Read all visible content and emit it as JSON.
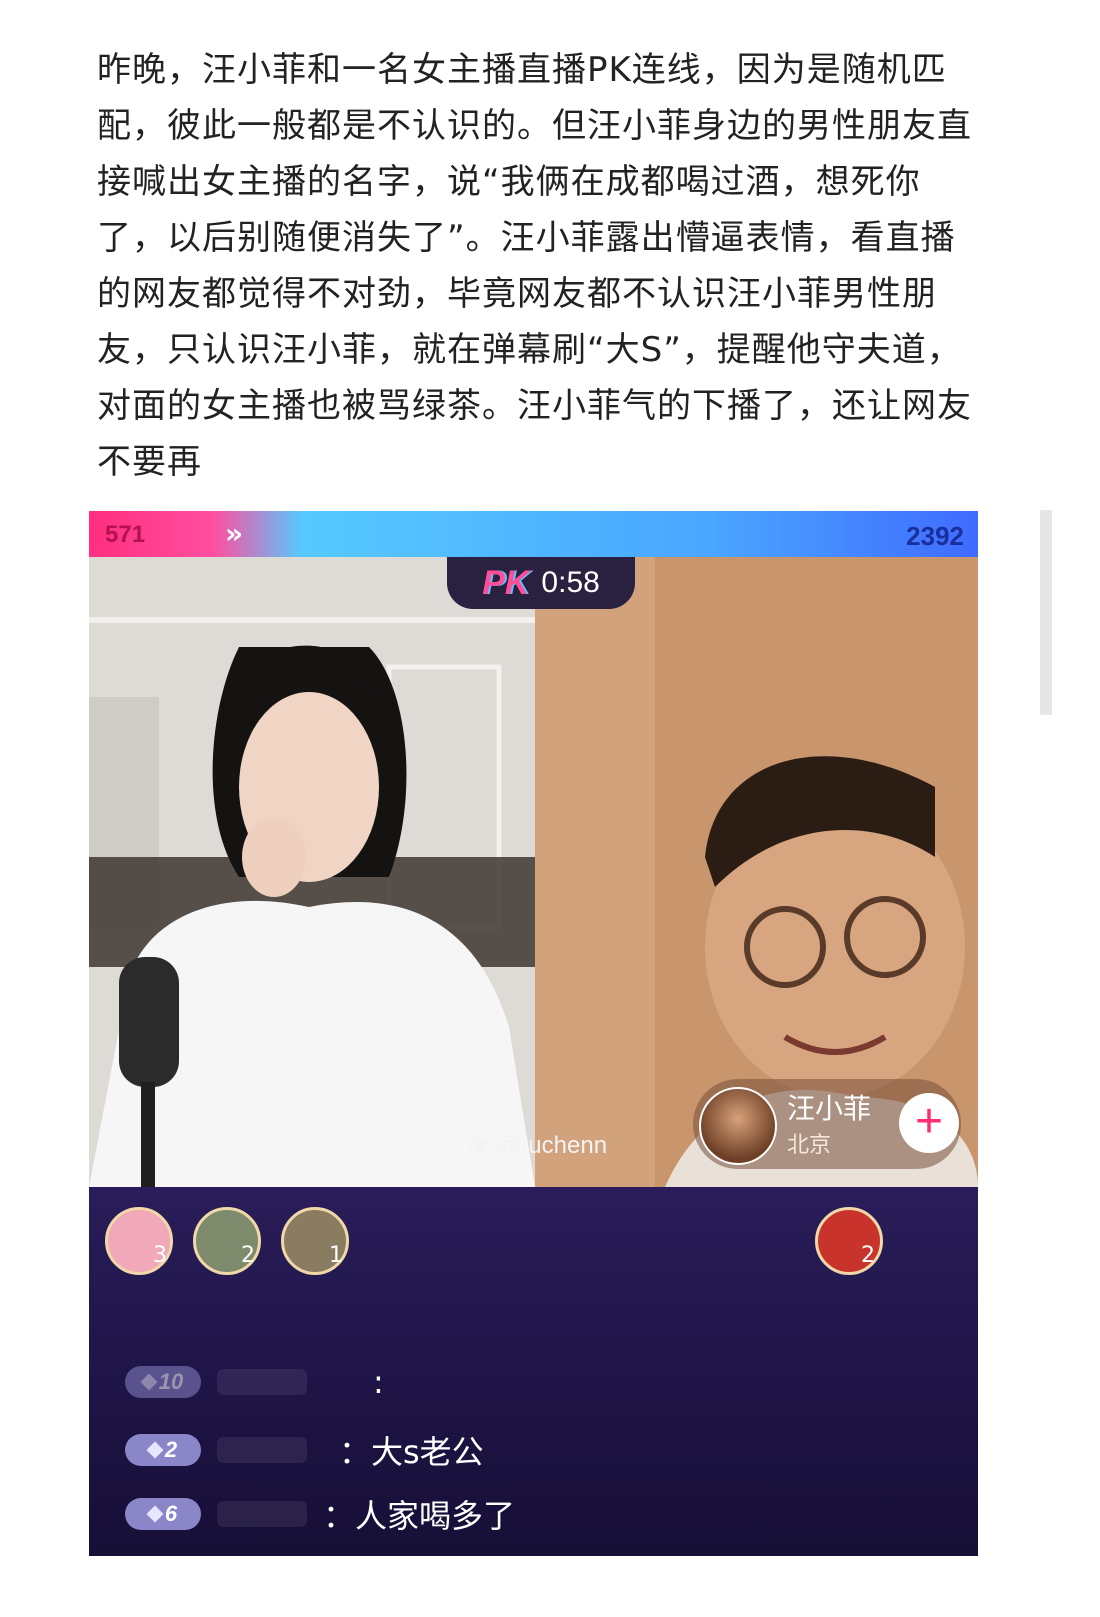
{
  "article": {
    "text": "昨晚，汪小菲和一名女主播直播PK连线，因为是随机匹配，彼此一般都是不认识的。但汪小菲身边的男性朋友直接喊出女主播的名字，说“我俩在成都喝过酒，想死你了，以后别随便消失了”。汪小菲露出懵逼表情，看直播的网友都觉得不对劲，毕竟网友都不认识汪小菲男性朋友，只认识汪小菲，就在弹幕刷“大S”，提醒他守夫道，对面的女主播也被骂绿茶。汪小菲气的下播了，还让网友不要再"
  },
  "stream": {
    "score_left": "571",
    "score_right": "2392",
    "pk_logo": "PK",
    "timer": "0:58",
    "watermark": "@ruchenn",
    "host": {
      "name": "汪小菲",
      "location": "北京",
      "follow": "+"
    },
    "fans_left": [
      {
        "count": "3",
        "color": "#e23a6e"
      },
      {
        "count": "2",
        "color": "#6b7b5a"
      },
      {
        "count": "1",
        "color": "#7a6d52"
      }
    ],
    "fans_right": [
      {
        "count": "2",
        "color": "#c8342c"
      }
    ],
    "chat": [
      {
        "level": "10",
        "text": ":"
      },
      {
        "level": "2",
        "text": "：大s老公"
      },
      {
        "level": "6",
        "text": "：人家喝多了"
      }
    ]
  }
}
